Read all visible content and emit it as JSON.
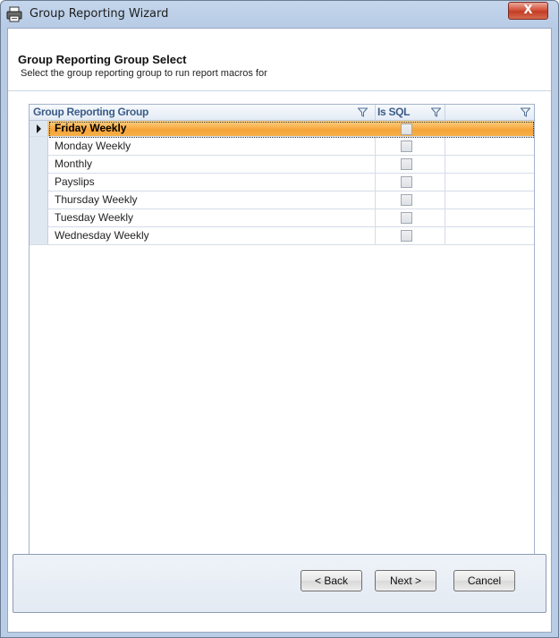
{
  "window": {
    "title": "Group Reporting Wizard",
    "close_label": "X"
  },
  "header": {
    "title": "Group Reporting Group Select",
    "subtitle": "Select the group reporting group to run report macros for"
  },
  "grid": {
    "columns": [
      {
        "label": "Group Reporting Group"
      },
      {
        "label": "Is SQL"
      },
      {
        "label": ""
      }
    ],
    "rows": [
      {
        "name": "Friday Weekly",
        "is_sql": false,
        "selected": true
      },
      {
        "name": "Monday Weekly",
        "is_sql": false,
        "selected": false
      },
      {
        "name": "Monthly",
        "is_sql": false,
        "selected": false
      },
      {
        "name": "Payslips",
        "is_sql": false,
        "selected": false
      },
      {
        "name": "Thursday Weekly",
        "is_sql": false,
        "selected": false
      },
      {
        "name": "Tuesday Weekly",
        "is_sql": false,
        "selected": false
      },
      {
        "name": "Wednesday Weekly",
        "is_sql": false,
        "selected": false
      }
    ]
  },
  "buttons": {
    "back": "< Back",
    "next": "Next >",
    "cancel": "Cancel"
  },
  "colors": {
    "selected_row": "#f7a437",
    "header_text": "#3b5c88"
  }
}
